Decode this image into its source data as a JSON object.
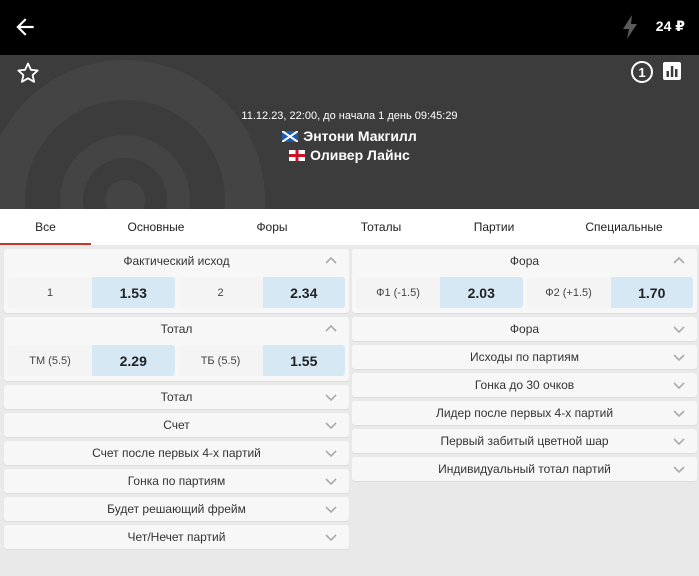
{
  "header": {
    "balance": "24 ₽"
  },
  "match": {
    "info": "11.12.23, 22:00, до начала  1 день  09:45:29",
    "player1": "Энтони Макгилл",
    "player2": "Оливер Лайнс",
    "live_badge": "1"
  },
  "tabs": [
    "Все",
    "Основные",
    "Форы",
    "Тоталы",
    "Партии",
    "Специальные"
  ],
  "left": {
    "outcome": {
      "title": "Фактический исход",
      "odds": [
        {
          "label": "1",
          "value": "1.53"
        },
        {
          "label": "2",
          "value": "2.34"
        }
      ]
    },
    "total": {
      "title": "Тотал",
      "odds": [
        {
          "label": "ТМ (5.5)",
          "value": "2.29"
        },
        {
          "label": "ТБ (5.5)",
          "value": "1.55"
        }
      ]
    },
    "collapsed": [
      "Тотал",
      "Счет",
      "Счет после первых 4-х партий",
      "Гонка по партиям",
      "Будет решающий фрейм",
      "Чет/Нечет партий"
    ]
  },
  "right": {
    "handicap": {
      "title": "Фора",
      "odds": [
        {
          "label": "Ф1 (-1.5)",
          "value": "2.03"
        },
        {
          "label": "Ф2 (+1.5)",
          "value": "1.70"
        }
      ]
    },
    "collapsed": [
      "Фора",
      "Исходы по партиям",
      "Гонка до 30 очков",
      "Лидер после первых 4-х партий",
      "Первый забитый цветной шар",
      "Индивидуальный тотал партий"
    ]
  }
}
